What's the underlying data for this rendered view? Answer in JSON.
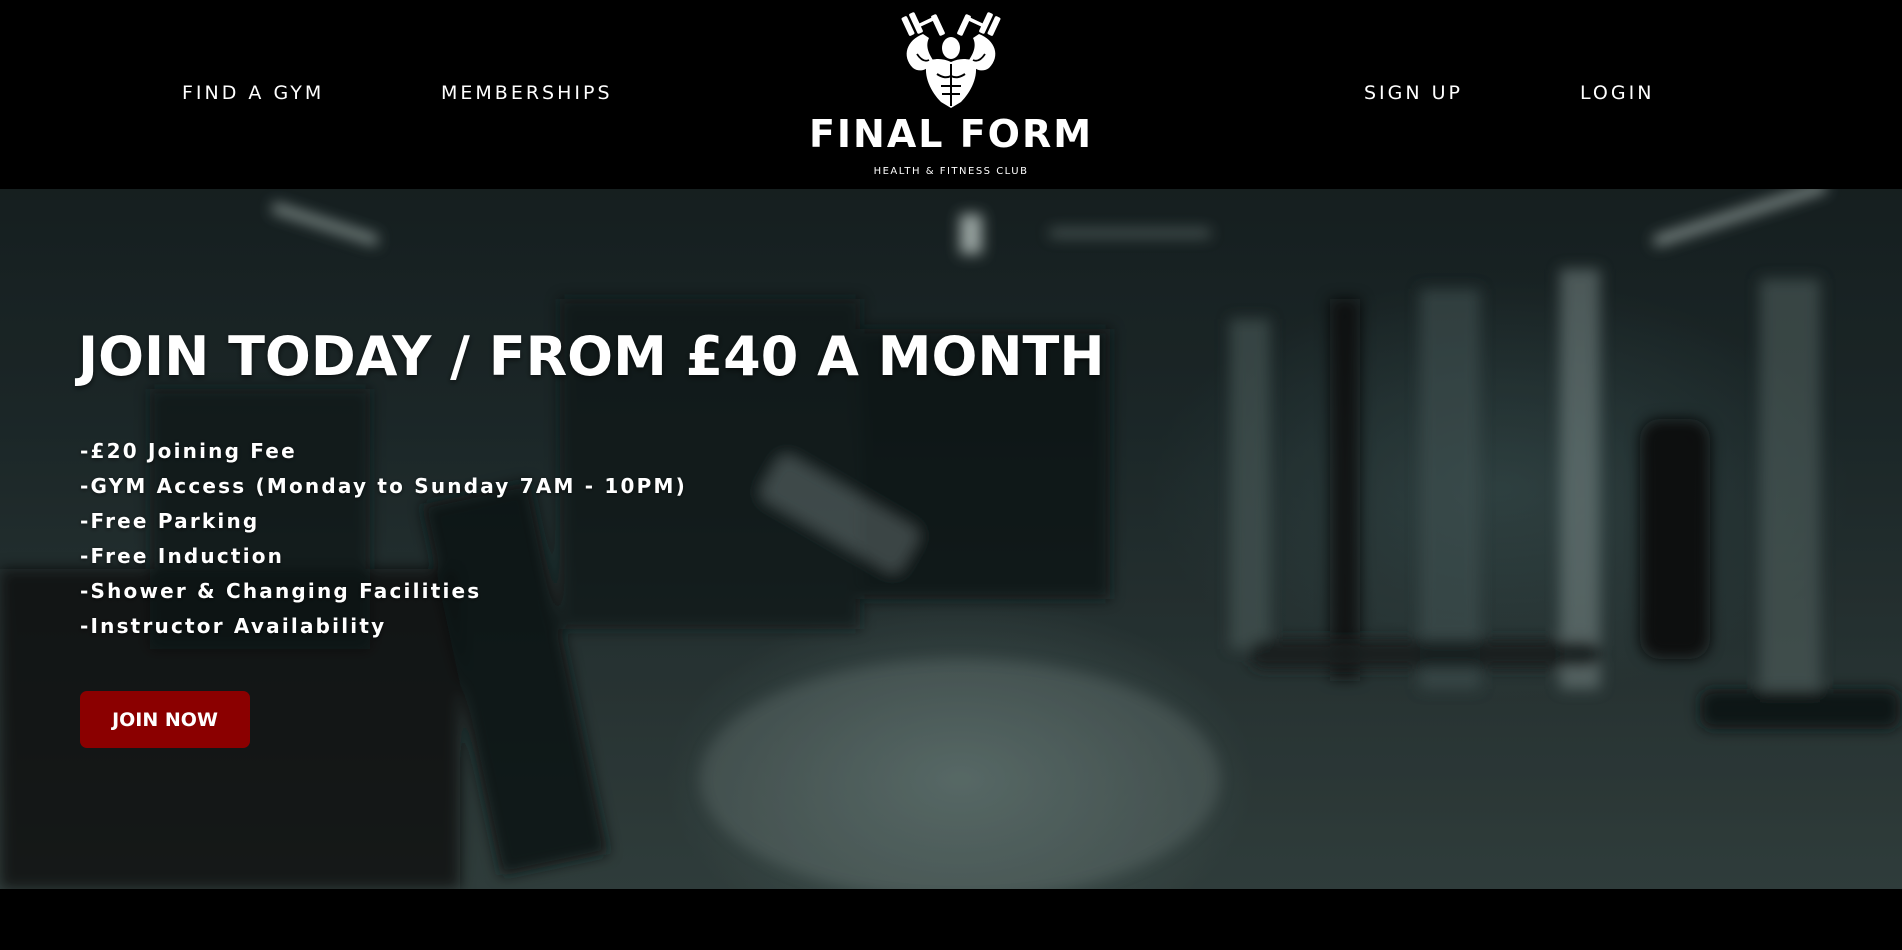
{
  "header": {
    "nav_left": [
      "FIND A GYM",
      "MEMBERSHIPS"
    ],
    "nav_right": [
      "SIGN UP",
      "LOGIN"
    ],
    "logo": {
      "name": "FINAL FORM",
      "tagline": "HEALTH & FITNESS CLUB",
      "icon": "flexing-bodybuilder-with-dumbbells-icon"
    }
  },
  "hero": {
    "title": "JOIN TODAY / FROM £40 A MONTH",
    "features": [
      "-£20 Joining Fee",
      "-GYM Access (Monday to Sunday 7AM - 10PM)",
      "-Free Parking",
      "-Free Induction",
      "-Shower & Changing Facilities",
      "-Instructor Availability"
    ],
    "cta_label": "JOIN NOW",
    "background": "blurred dark gym interior photo"
  },
  "colors": {
    "header_bg": "#000000",
    "cta_bg": "#8b0000",
    "text": "#ffffff"
  }
}
